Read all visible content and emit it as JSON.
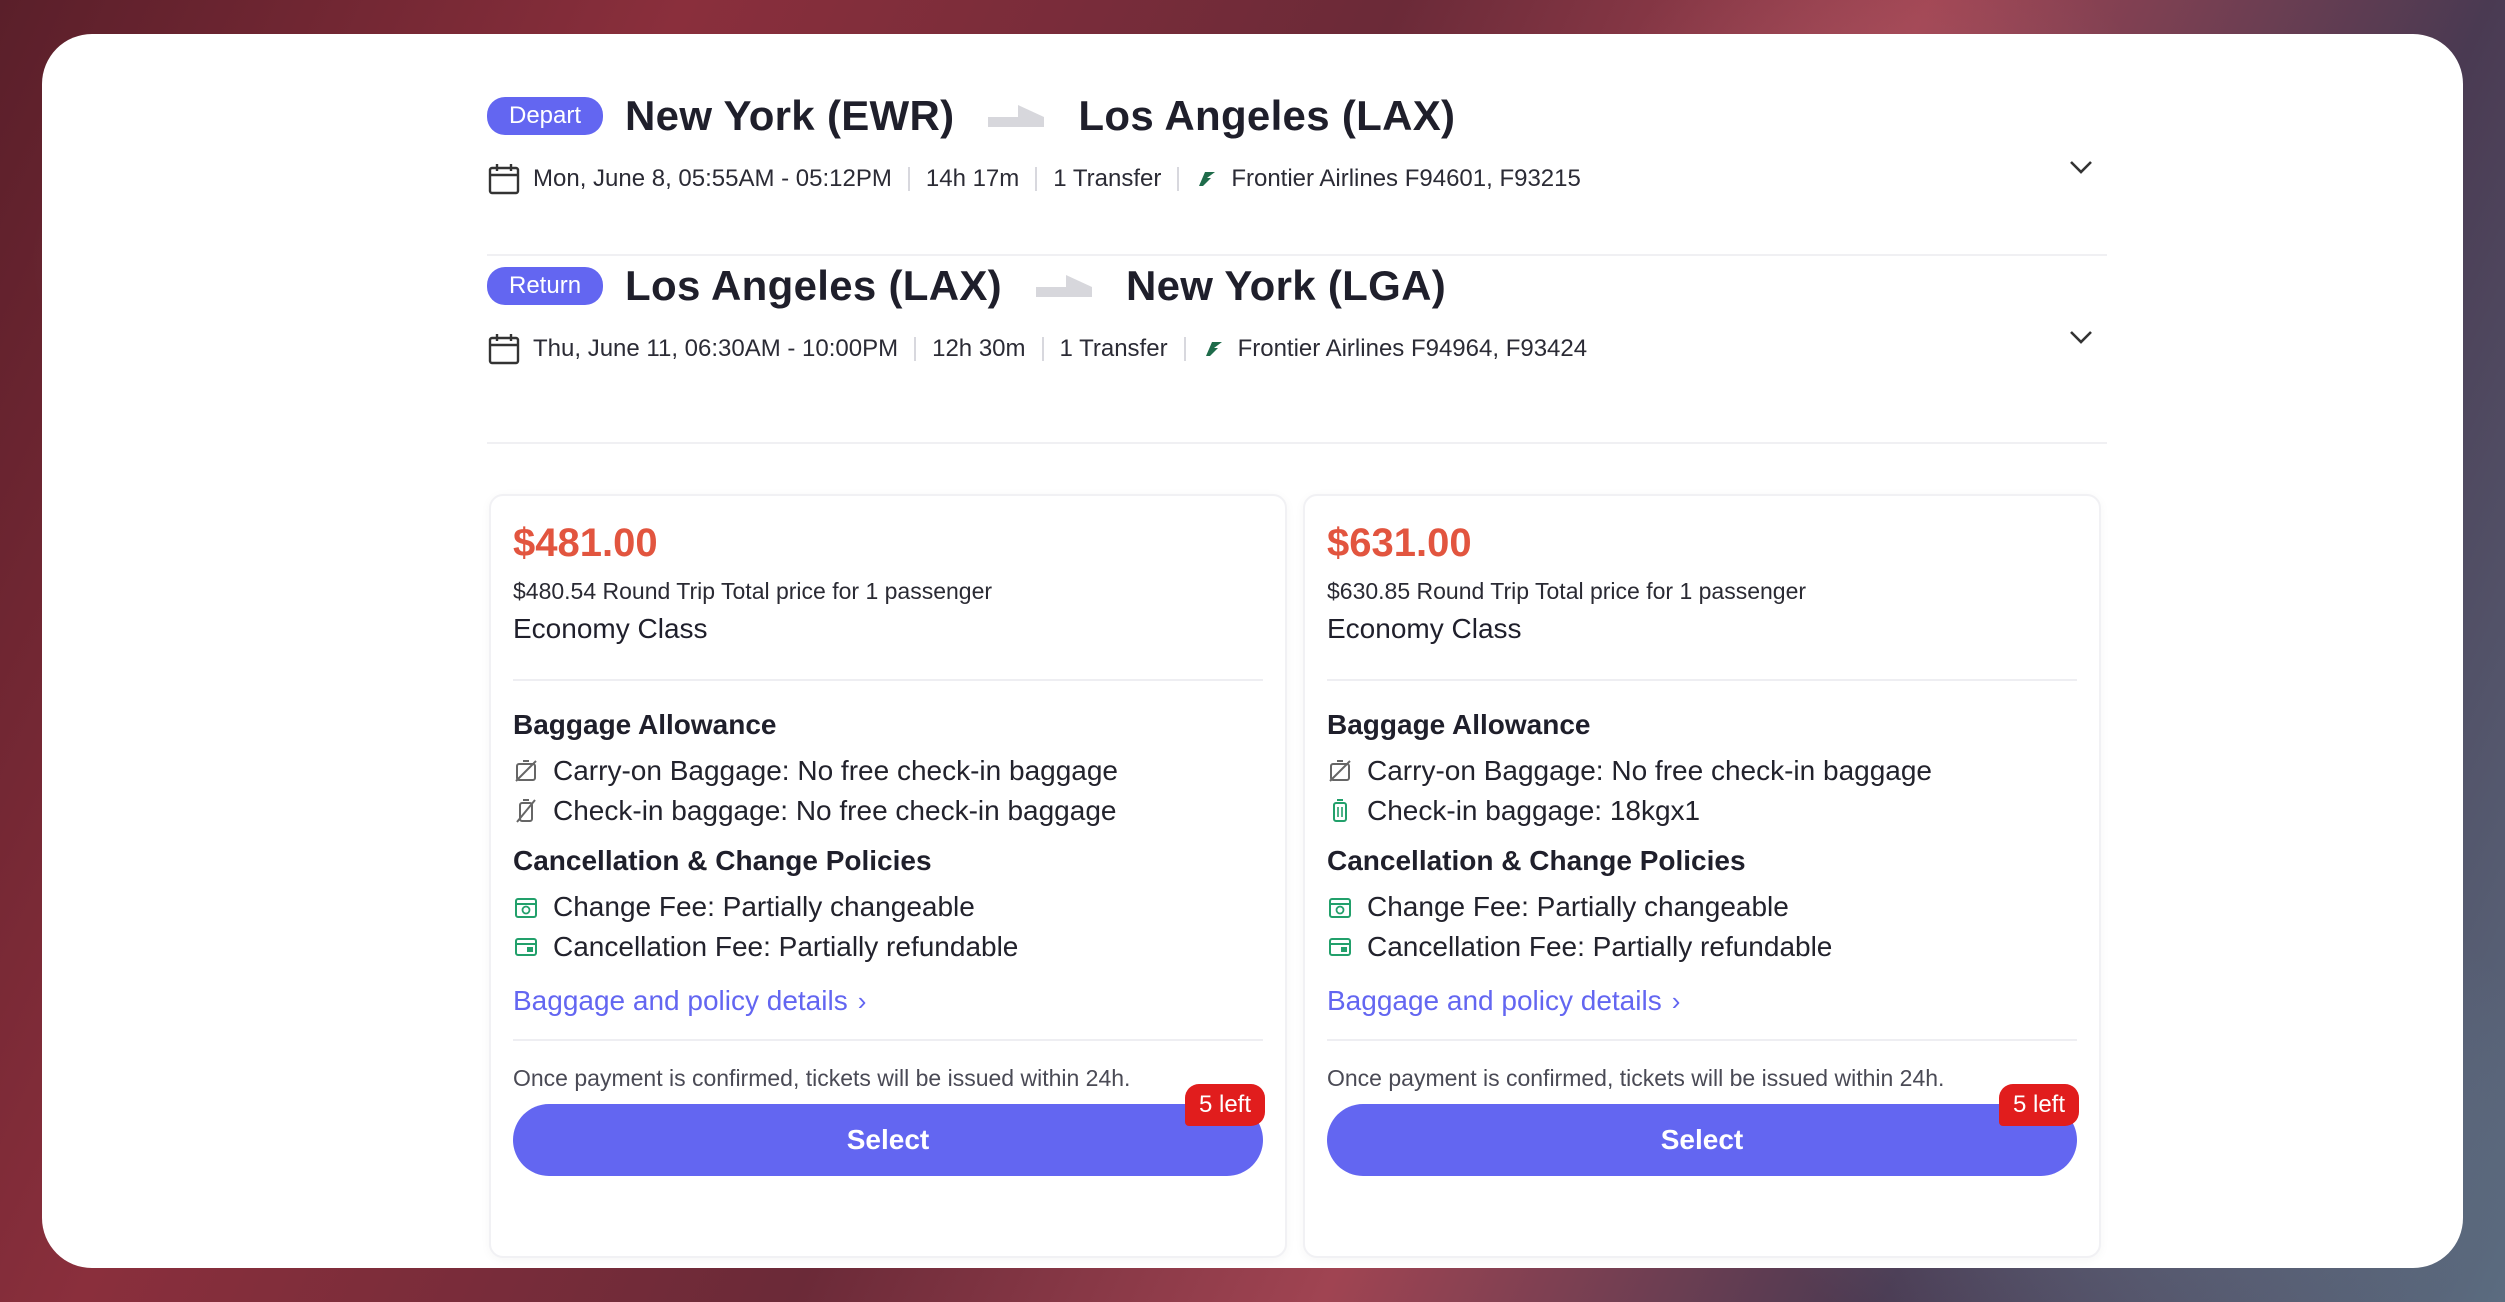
{
  "flights": {
    "depart": {
      "badge": "Depart",
      "from": "New York (EWR)",
      "to": "Los Angeles (LAX)",
      "datetime": "Mon, June 8, 05:55AM - 05:12PM",
      "duration": "14h 17m",
      "transfers": "1 Transfer",
      "airline": "Frontier Airlines F94601, F93215"
    },
    "return": {
      "badge": "Return",
      "from": "Los Angeles (LAX)",
      "to": "New York (LGA)",
      "datetime": "Thu, June 11, 06:30AM - 10:00PM",
      "duration": "12h 30m",
      "transfers": "1 Transfer",
      "airline": "Frontier Airlines F94964, F93424"
    }
  },
  "fares": [
    {
      "price": "$481.00",
      "total": "$480.54 Round Trip Total price for 1 passenger",
      "cabin": "Economy Class",
      "baggage_title": "Baggage Allowance",
      "carry_on": "Carry-on Baggage: No free check-in baggage",
      "check_in": "Check-in baggage: No free check-in baggage",
      "policy_title": "Cancellation & Change Policies",
      "change_fee": "Change Fee: Partially changeable",
      "cancel_fee": "Cancellation Fee: Partially refundable",
      "details_link": "Baggage and policy details",
      "note": "Once payment is confirmed, tickets will be issued within 24h.",
      "select_label": "Select",
      "seats_left": "5 left"
    },
    {
      "price": "$631.00",
      "total": "$630.85 Round Trip Total price for 1 passenger",
      "cabin": "Economy Class",
      "baggage_title": "Baggage Allowance",
      "carry_on": "Carry-on Baggage: No free check-in baggage",
      "check_in": "Check-in baggage: 18kgx1",
      "policy_title": "Cancellation & Change Policies",
      "change_fee": "Change Fee: Partially changeable",
      "cancel_fee": "Cancellation Fee: Partially refundable",
      "details_link": "Baggage and policy details",
      "note": "Once payment is confirmed, tickets will be issued within 24h.",
      "select_label": "Select",
      "seats_left": "5 left"
    }
  ],
  "colors": {
    "accent": "#6366f1",
    "price": "#e2553f",
    "badge_red": "#e11d1d",
    "policy_green": "#22a06b"
  }
}
